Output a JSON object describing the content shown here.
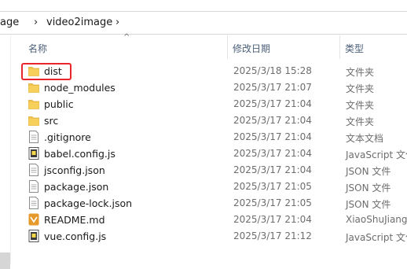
{
  "breadcrumb": {
    "parent": "age",
    "current": "video2image",
    "separator": "›"
  },
  "columns": {
    "name": "名称",
    "date": "修改日期",
    "type": "类型"
  },
  "files": [
    {
      "name": "dist",
      "date": "2025/3/18 15:28",
      "type": "文件夹",
      "icon": "folder-icon"
    },
    {
      "name": "node_modules",
      "date": "2025/3/17 21:07",
      "type": "文件夹",
      "icon": "folder-icon"
    },
    {
      "name": "public",
      "date": "2025/3/17 21:04",
      "type": "文件夹",
      "icon": "folder-icon"
    },
    {
      "name": "src",
      "date": "2025/3/17 21:04",
      "type": "文件夹",
      "icon": "folder-icon"
    },
    {
      "name": ".gitignore",
      "date": "2025/3/17 21:04",
      "type": "文本文档",
      "icon": "text-file-icon"
    },
    {
      "name": "babel.config.js",
      "date": "2025/3/17 21:04",
      "type": "JavaScript 文件",
      "icon": "js-file-icon"
    },
    {
      "name": "jsconfig.json",
      "date": "2025/3/17 21:04",
      "type": "JSON 文件",
      "icon": "json-file-icon"
    },
    {
      "name": "package.json",
      "date": "2025/3/17 21:05",
      "type": "JSON 文件",
      "icon": "json-file-icon"
    },
    {
      "name": "package-lock.json",
      "date": "2025/3/17 21:05",
      "type": "JSON 文件",
      "icon": "json-file-icon"
    },
    {
      "name": "README.md",
      "date": "2025/3/17 21:04",
      "type": "XiaoShuJiang",
      "icon": "markdown-file-icon"
    },
    {
      "name": "vue.config.js",
      "date": "2025/3/17 21:12",
      "type": "JavaScript 文件",
      "icon": "js-file-icon"
    }
  ],
  "colors": {
    "highlight": "#e8262b",
    "folder": "#f3c44f",
    "header_text": "#4c607a"
  }
}
